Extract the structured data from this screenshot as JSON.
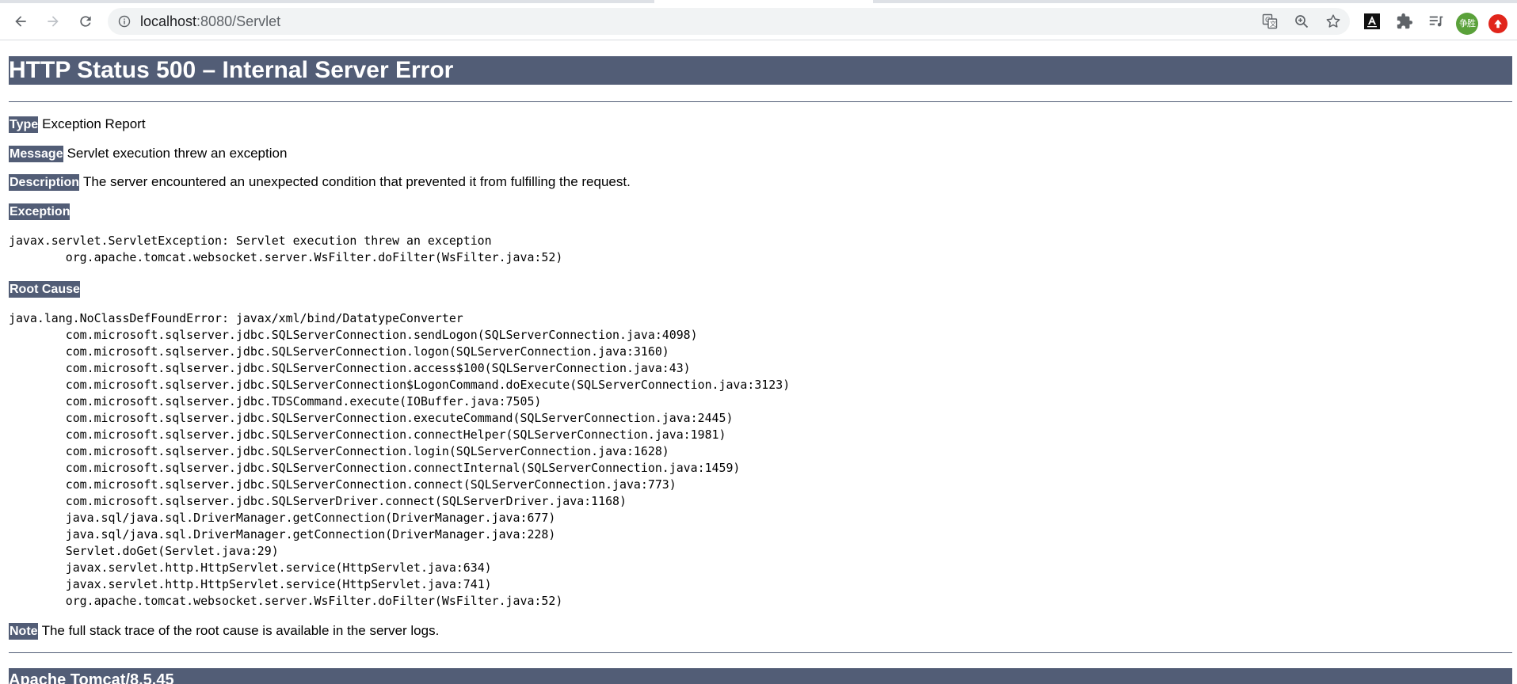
{
  "browser": {
    "url_host": "localhost",
    "url_path": ":8080/Servlet",
    "avatar_text": "争胜",
    "icons": {
      "back": "arrow-left-icon",
      "forward": "arrow-right-icon",
      "reload": "reload-icon",
      "site_info": "info-icon",
      "translate": "translate-icon",
      "zoom": "zoom-icon",
      "bookmark": "star-icon",
      "extension_1": "extension-a-icon",
      "extensions": "puzzle-icon",
      "media": "media-queue-icon",
      "update": "update-icon"
    }
  },
  "page": {
    "title": "HTTP Status 500 – Internal Server Error",
    "type_label": "Type",
    "type_text": "Exception Report",
    "message_label": "Message",
    "message_text": "Servlet execution threw an exception",
    "description_label": "Description",
    "description_text": "The server encountered an unexpected condition that prevented it from fulfilling the request.",
    "exception_label": "Exception",
    "exception_trace": "javax.servlet.ServletException: Servlet execution threw an exception\n\torg.apache.tomcat.websocket.server.WsFilter.doFilter(WsFilter.java:52)",
    "root_cause_label": "Root Cause",
    "root_cause_trace": "java.lang.NoClassDefFoundError: javax/xml/bind/DatatypeConverter\n\tcom.microsoft.sqlserver.jdbc.SQLServerConnection.sendLogon(SQLServerConnection.java:4098)\n\tcom.microsoft.sqlserver.jdbc.SQLServerConnection.logon(SQLServerConnection.java:3160)\n\tcom.microsoft.sqlserver.jdbc.SQLServerConnection.access$100(SQLServerConnection.java:43)\n\tcom.microsoft.sqlserver.jdbc.SQLServerConnection$LogonCommand.doExecute(SQLServerConnection.java:3123)\n\tcom.microsoft.sqlserver.jdbc.TDSCommand.execute(IOBuffer.java:7505)\n\tcom.microsoft.sqlserver.jdbc.SQLServerConnection.executeCommand(SQLServerConnection.java:2445)\n\tcom.microsoft.sqlserver.jdbc.SQLServerConnection.connectHelper(SQLServerConnection.java:1981)\n\tcom.microsoft.sqlserver.jdbc.SQLServerConnection.login(SQLServerConnection.java:1628)\n\tcom.microsoft.sqlserver.jdbc.SQLServerConnection.connectInternal(SQLServerConnection.java:1459)\n\tcom.microsoft.sqlserver.jdbc.SQLServerConnection.connect(SQLServerConnection.java:773)\n\tcom.microsoft.sqlserver.jdbc.SQLServerDriver.connect(SQLServerDriver.java:1168)\n\tjava.sql/java.sql.DriverManager.getConnection(DriverManager.java:677)\n\tjava.sql/java.sql.DriverManager.getConnection(DriverManager.java:228)\n\tServlet.doGet(Servlet.java:29)\n\tjavax.servlet.http.HttpServlet.service(HttpServlet.java:634)\n\tjavax.servlet.http.HttpServlet.service(HttpServlet.java:741)\n\torg.apache.tomcat.websocket.server.WsFilter.doFilter(WsFilter.java:52)",
    "note_label": "Note",
    "note_text": "The full stack trace of the root cause is available in the server logs.",
    "footer": "Apache Tomcat/8.5.45"
  },
  "colors": {
    "header_bg": "#525d76",
    "header_text": "#ffffff",
    "omnibox_bg": "#f1f3f4",
    "avatar_bg": "#5aa13a",
    "update_bg": "#e1251b"
  }
}
